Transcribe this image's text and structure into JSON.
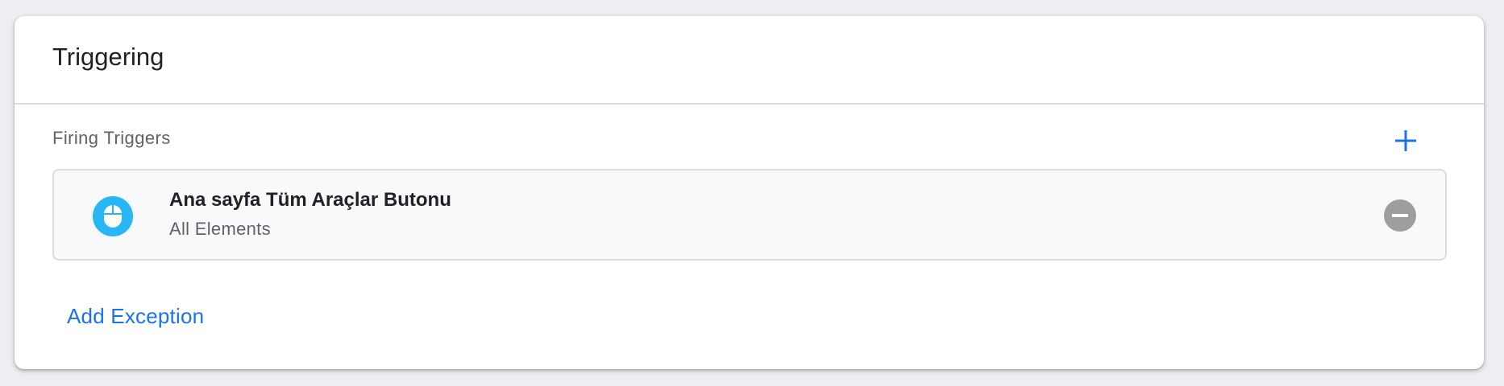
{
  "card": {
    "title": "Triggering"
  },
  "firing_triggers": {
    "label": "Firing Triggers",
    "add_icon": "plus-icon",
    "items": [
      {
        "name": "Ana sayfa Tüm Araçlar Butonu",
        "type": "All Elements",
        "icon": "mouse-click-icon",
        "icon_color": "#29b6f6",
        "remove_icon": "remove-circle-icon"
      }
    ]
  },
  "exceptions": {
    "add_label": "Add Exception"
  },
  "colors": {
    "accent": "#1a73e8",
    "trigger_icon_bg": "#29b6f6",
    "remove_icon_bg": "#9e9e9e"
  }
}
